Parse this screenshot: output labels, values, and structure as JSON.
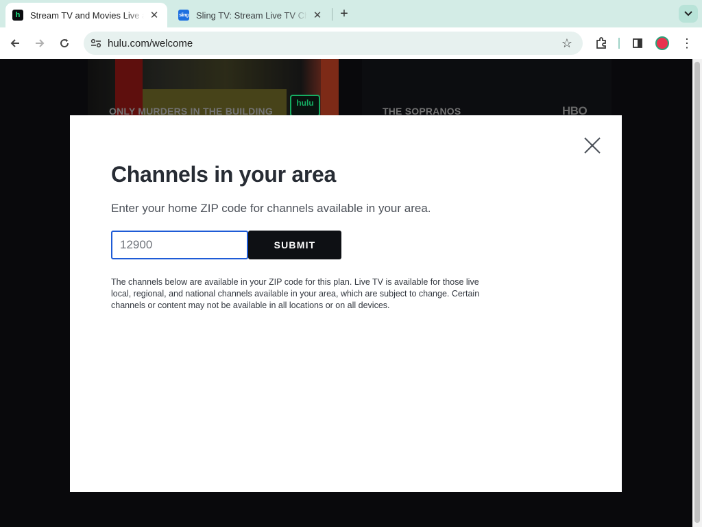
{
  "browser": {
    "tabs": [
      {
        "title": "Stream TV and Movies Live and Online | Hulu",
        "favicon": "h",
        "active": true
      },
      {
        "title": "Sling TV: Stream Live TV Channels",
        "favicon": "sling",
        "active": false
      }
    ],
    "url": "hulu.com/welcome"
  },
  "background": {
    "cards": [
      {
        "title": "ONLY MURDERS IN THE BUILDING",
        "badge": "hulu"
      },
      {
        "title": "THE SOPRANOS",
        "badge": "HBO"
      }
    ]
  },
  "modal": {
    "title": "Channels in your area",
    "subtitle": "Enter your home ZIP code for channels available in your area.",
    "zip_value": "12900",
    "submit_label": "SUBMIT",
    "disclaimer": "The channels below are available in your ZIP code for this plan. Live TV is available for those live local, regional, and national channels available in your area, which are subject to change. Certain channels or content may not be available in all locations or on all devices."
  },
  "colors": {
    "accent": "#1e5bd6",
    "brand_hulu": "#1ce783",
    "button_dark": "#0e1014"
  },
  "icons": [
    "back-arrow-icon",
    "forward-arrow-icon",
    "reload-icon",
    "site-info-icon",
    "bookmark-star-icon",
    "extensions-icon",
    "side-panel-icon",
    "kebab-menu-icon",
    "close-icon",
    "plus-icon",
    "chevron-down-icon"
  ]
}
